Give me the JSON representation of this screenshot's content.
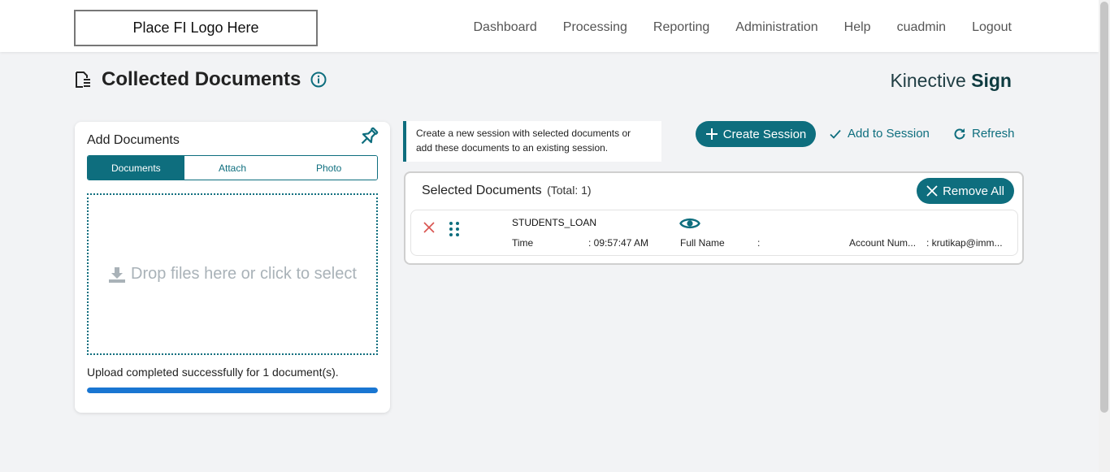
{
  "header": {
    "logo_text": "Place FI Logo Here",
    "nav": [
      "Dashboard",
      "Processing",
      "Reporting",
      "Administration",
      "Help",
      "cuadmin",
      "Logout"
    ]
  },
  "page": {
    "title": "Collected Documents",
    "brand_light": "Kinective",
    "brand_bold": "Sign"
  },
  "add_documents": {
    "title": "Add Documents",
    "tabs": [
      {
        "label": "Documents",
        "active": true
      },
      {
        "label": "Attach",
        "active": false
      },
      {
        "label": "Photo",
        "active": false
      }
    ],
    "drop_text": "Drop files here or click to select",
    "upload_message": "Upload completed successfully for 1 document(s).",
    "progress_fraction": 1.0
  },
  "session": {
    "hint_line1": "Create a new session with selected documents or",
    "hint_line2": "add these documents to an existing session.",
    "create_label": "Create Session",
    "add_label": "Add to Session",
    "refresh_label": "Refresh"
  },
  "selected": {
    "title": "Selected Documents",
    "total": "(Total: 1)",
    "remove_all_label": "Remove All",
    "rows": [
      {
        "name": "STUDENTS_LOAN",
        "time_label": "Time",
        "time_value": ": 09:57:47 AM",
        "fullname_label": "Full Name",
        "fullname_value": ":",
        "account_label": "Account Num...",
        "account_value": ": krutikap@imm..."
      }
    ]
  },
  "colors": {
    "accent": "#0e6e7e",
    "progress": "#1976d2",
    "remove_x": "#d9534f"
  }
}
